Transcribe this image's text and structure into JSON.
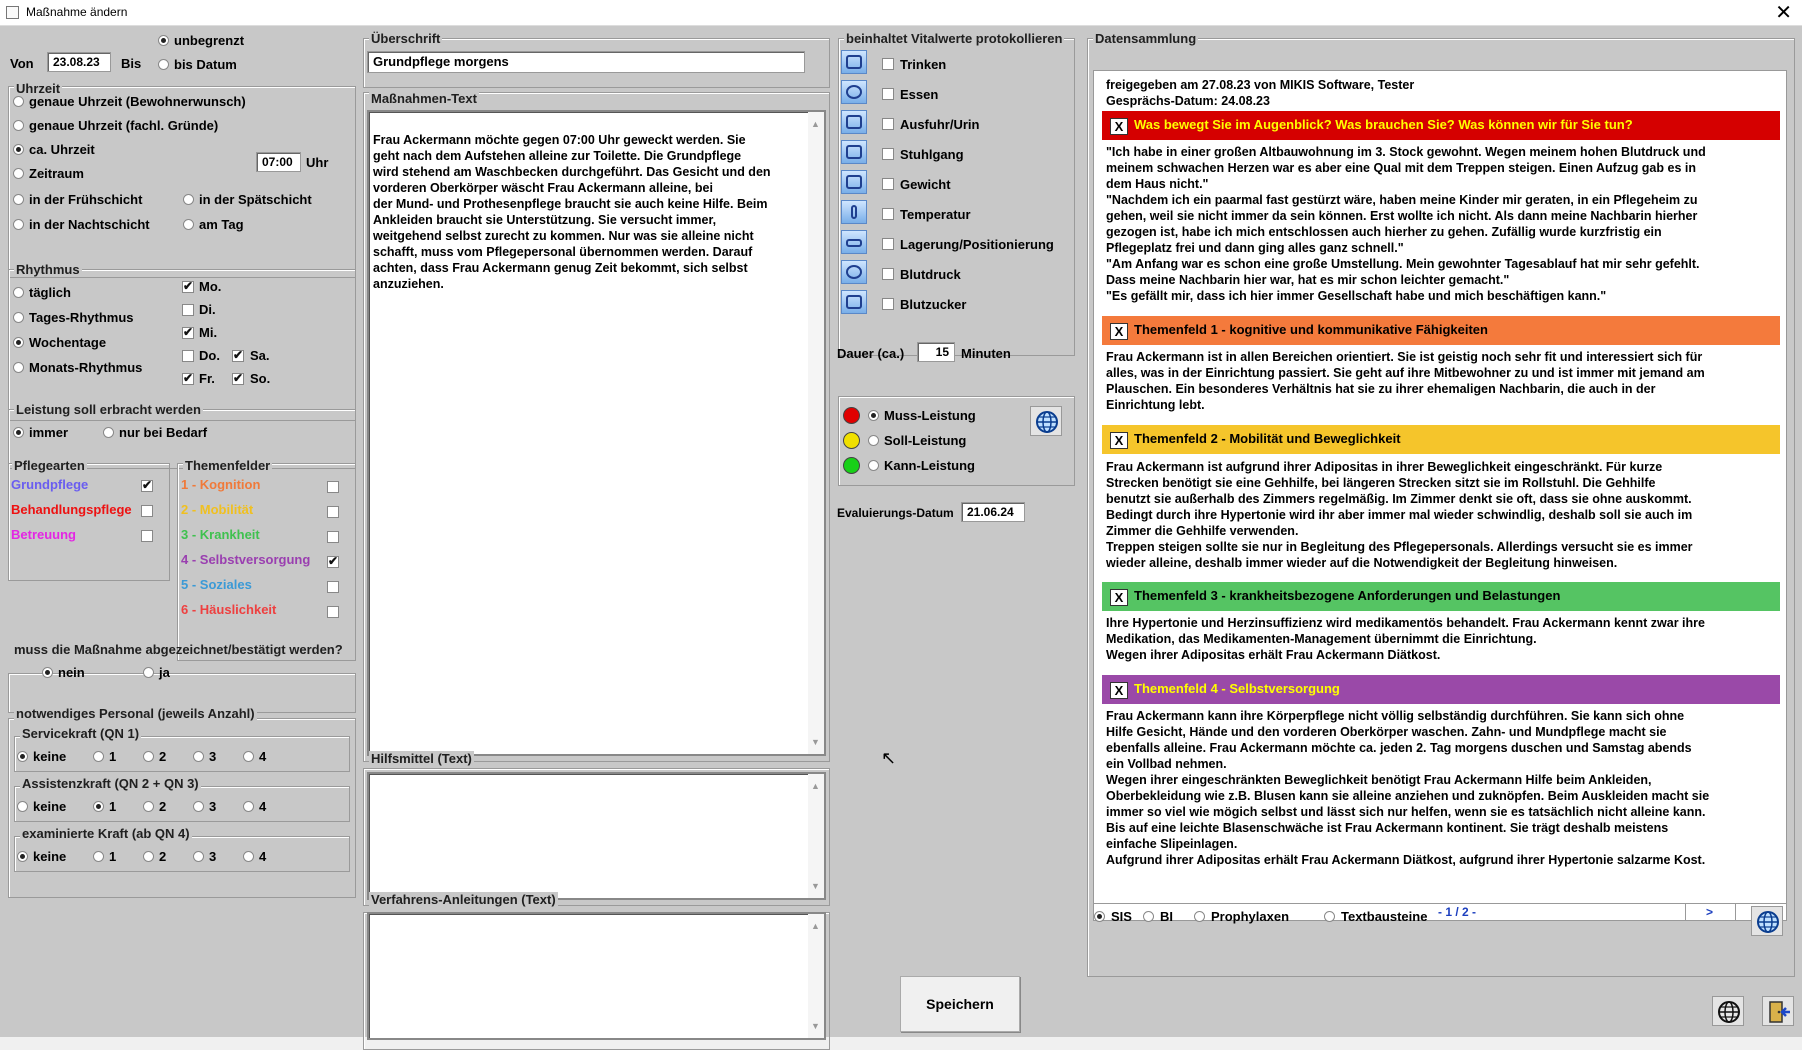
{
  "window": {
    "title": "Maßnahme ändern",
    "close": "✕"
  },
  "period": {
    "von_label": "Von",
    "von_value": "23.08.23",
    "bis_label": "Bis",
    "unbegrenzt": "unbegrenzt",
    "bis_datum": "bis Datum"
  },
  "uhrzeit": {
    "title": "Uhrzeit",
    "opt_genau_bew": "genaue Uhrzeit (Bewohnerwunsch)",
    "opt_genau_fach": "genaue Uhrzeit (fachl. Gründe)",
    "opt_ca": "ca. Uhrzeit",
    "time_value": "07:00",
    "time_unit": "Uhr",
    "opt_zeitraum": "Zeitraum",
    "opt_frueh": "in der Frühschicht",
    "opt_spaet": "in der Spätschicht",
    "opt_nacht": "in der Nachtschicht",
    "opt_tag": "am Tag"
  },
  "rhythmus": {
    "title": "Rhythmus",
    "opt_taeglich": "täglich",
    "opt_tages": "Tages-Rhythmus",
    "opt_wochentage": "Wochentage",
    "opt_monats": "Monats-Rhythmus",
    "days": {
      "mo": "Mo.",
      "di": "Di.",
      "mi": "Mi.",
      "do": "Do.",
      "sa": "Sa.",
      "fr": "Fr.",
      "so": "So."
    }
  },
  "leistung": {
    "title": "Leistung soll erbracht werden",
    "immer": "immer",
    "bedarf": "nur bei Bedarf"
  },
  "pflegearten": {
    "title": "Pflegearten",
    "grund": "Grundpflege",
    "behandlung": "Behandlungspflege",
    "betreuung": "Betreuung"
  },
  "themenfelder": {
    "title": "Themenfelder",
    "t1": "1 - Kognition",
    "t2": "2 - Mobilität",
    "t3": "3 - Krankheit",
    "t4": "4 - Selbstversorgung",
    "t5": "5 - Soziales",
    "t6": "6 - Häuslichkeit"
  },
  "bestaetigung": {
    "title": "muss die Maßnahme abgezeichnet/bestätigt werden?",
    "nein": "nein",
    "ja": "ja"
  },
  "personal": {
    "title": "notwendiges Personal (jeweils Anzahl)",
    "service": "Servicekraft (QN 1)",
    "assistenz": "Assistenzkraft (QN 2 + QN 3)",
    "examiniert": "examinierte Kraft (ab QN 4)",
    "keine": "keine",
    "n1": "1",
    "n2": "2",
    "n3": "3",
    "n4": "4"
  },
  "ueberschrift": {
    "title": "Überschrift",
    "value": "Grundpflege morgens"
  },
  "massnahmen": {
    "title": "Maßnahmen-Text",
    "text": "Frau Ackermann möchte gegen 07:00 Uhr geweckt werden. Sie\ngeht nach dem Aufstehen alleine zur Toilette. Die Grundpflege\nwird stehend am Waschbecken durchgeführt. Das Gesicht und den\nvorderen Oberkörper wäscht Frau Ackermann alleine, bei\nder Mund- und Prothesenpflege braucht sie auch keine Hilfe. Beim\nAnkleiden braucht sie Unterstützung. Sie versucht immer,\nweitgehend selbst zurecht zu kommen. Nur was sie alleine nicht\nschafft, muss vom Pflegepersonal übernommen werden. Darauf\nachten, dass Frau Ackermann genug Zeit bekommt, sich selbst\nanzuziehen."
  },
  "hilfsmittel": {
    "title": "Hilfsmittel (Text)",
    "value": ""
  },
  "verfahren": {
    "title": "Verfahrens-Anleitungen (Text)",
    "value": ""
  },
  "vital": {
    "title": "beinhaltet Vitalwerte protokollieren",
    "trinken": "Trinken",
    "essen": "Essen",
    "ausfuhr": "Ausfuhr/Urin",
    "stuhlgang": "Stuhlgang",
    "gewicht": "Gewicht",
    "temperatur": "Temperatur",
    "lagerung": "Lagerung/Positionierung",
    "blutdruck": "Blutdruck",
    "blutzucker": "Blutzucker"
  },
  "dauer": {
    "label": "Dauer (ca.)",
    "value": "15",
    "unit": "Minuten"
  },
  "priority": {
    "muss": "Muss-Leistung",
    "soll": "Soll-Leistung",
    "kann": "Kann-Leistung"
  },
  "evaluierung": {
    "label": "Evaluierungs-Datum",
    "value": "21.06.24"
  },
  "datensammlung": {
    "title": "Datensammlung",
    "freigegeben": "freigegeben am 27.08.23 von MIKIS Software, Tester",
    "gespraech": "Gesprächs-Datum: 24.08.23",
    "x": "X",
    "q_title": "Was bewegt Sie im Augenblick? Was brauchen Sie? Was können wir für Sie tun?",
    "q_text": "\"Ich habe in einer großen Altbauwohnung im 3. Stock gewohnt. Wegen meinem hohen Blutdruck und\nmeinem schwachen Herzen war es aber eine Qual mit dem Treppen steigen. Einen Aufzug gab es in\ndem Haus nicht.\"\n\"Nachdem ich ein paarmal fast gestürzt wäre, haben meine Kinder mir geraten, in ein Pflegeheim zu\ngehen, weil sie nicht immer da sein können. Erst wollte ich nicht. Als dann meine Nachbarin hierher\ngezogen ist, habe ich mich entschlossen auch hierher zu gehen. Zufällig wurde kurzfristig ein\nPflegeplatz frei und dann ging alles ganz schnell.\"\n\"Am Anfang war es schon eine große Umstellung. Mein gewohnter Tagesablauf hat mir sehr gefehlt.\nDass meine Nachbarin hier war, hat es mir schon leichter gemacht.\"\n\"Es gefällt mir, dass ich hier immer Gesellschaft habe und mich beschäftigen kann.\"",
    "t1_title": "Themenfeld 1 - kognitive und kommunikative Fähigkeiten",
    "t1_text": "Frau Ackermann ist in allen Bereichen orientiert. Sie ist geistig noch sehr fit und interessiert sich für\nalles, was in der Einrichtung passiert. Sie geht auf ihre Mitbewohner zu und ist immer mit jemand am\nPlauschen. Ein besonderes Verhältnis hat sie zu ihrer ehemaligen Nachbarin, die auch in der\nEinrichtung lebt.",
    "t2_title": "Themenfeld 2 - Mobilität und Beweglichkeit",
    "t2_text": "Frau Ackermann ist aufgrund ihrer Adipositas in ihrer Beweglichkeit eingeschränkt. Für kurze\nStrecken benötigt sie eine Gehhilfe, bei längeren Strecken sitzt sie im Rollstuhl. Die Gehhilfe\nbenutzt sie außerhalb des Zimmers regelmäßig. Im Zimmer denkt sie oft, dass sie ohne auskommt.\nBedingt durch ihre Hypertonie wird ihr aber immer mal wieder schwindlig, deshalb soll sie auch im\nZimmer die Gehhilfe verwenden.\nTreppen steigen sollte sie nur in Begleitung des Pflegepersonals. Allerdings versucht sie es immer\nwieder alleine, deshalb immer wieder auf die Notwendigkeit der Begleitung hinweisen.",
    "t3_title": "Themenfeld 3 - krankheitsbezogene Anforderungen und Belastungen",
    "t3_text": "Ihre Hypertonie und Herzinsuffizienz wird medikamentös behandelt. Frau Ackermann kennt zwar ihre\nMedikation, das Medikamenten-Management übernimmt die Einrichtung.\nWegen ihrer Adipositas erhält Frau Ackermann Diätkost.",
    "t4_title": "Themenfeld 4 - Selbstversorgung",
    "t4_text": "Frau Ackermann kann ihre Körperpflege nicht völlig selbständig durchführen. Sie kann sich ohne\nHilfe Gesicht, Hände und den vorderen Oberkörper waschen. Zahn- und Mundpflege macht sie\nebenfalls alleine. Frau Ackermann möchte ca. jeden 2. Tag morgens duschen und Samstag abends\nein Vollbad nehmen.\nWegen ihrer eingeschränkten Beweglichkeit benötigt Frau Ackermann Hilfe beim Ankleiden,\nOberbekleidung wie z.B. Blusen kann sie alleine anziehen und zuknöpfen. Beim Auskleiden macht sie\nimmer so viel wie mögich selbst und lässt sich nur helfen, wenn sie es tatsächlich nicht alleine kann.\nBis auf eine leichte Blasenschwäche ist Frau Ackermann kontinent. Sie trägt deshalb meistens\neinfache Slipeinlagen.\nAufgrund ihrer Adipositas erhält Frau Ackermann Diätkost, aufgrund ihrer Hypertonie salzarme Kost.",
    "pager": "- 1 / 2 -",
    "next": ">",
    "last": "> >",
    "src_sis": "SIS",
    "src_bi": "BI",
    "src_proph": "Prophylaxen",
    "src_text": "Textbausteine"
  },
  "save_label": "Speichern",
  "colors": {
    "q": "#d50000",
    "t1": "#f47a3c",
    "t2": "#f5c52b",
    "t3": "#55c463",
    "t4": "#9a49a8"
  }
}
